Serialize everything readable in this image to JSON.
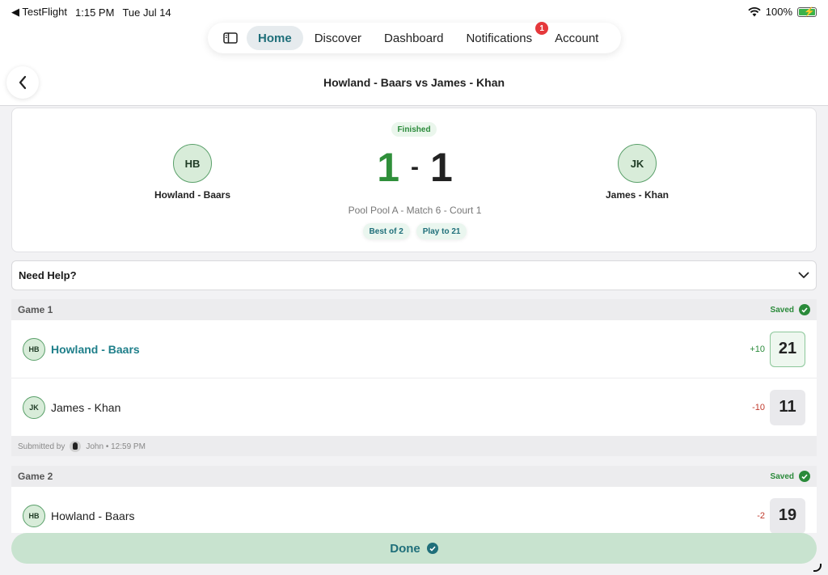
{
  "status": {
    "back_app": "◀ TestFlight",
    "time": "1:15 PM",
    "date": "Tue Jul 14",
    "battery": "100%"
  },
  "nav": {
    "items": [
      {
        "label": "Home"
      },
      {
        "label": "Discover"
      },
      {
        "label": "Dashboard"
      },
      {
        "label": "Notifications",
        "badge": "1"
      },
      {
        "label": "Account"
      }
    ]
  },
  "page": {
    "title": "Howland - Baars vs James - Khan"
  },
  "match": {
    "status": "Finished",
    "team_left": {
      "initials": "HB",
      "name": "Howland - Baars"
    },
    "team_right": {
      "initials": "JK",
      "name": "James - Khan"
    },
    "score_left": "1",
    "score_sep": "-",
    "score_right": "1",
    "info": "Pool Pool A - Match 6 - Court 1",
    "pills": [
      "Best of 2",
      "Play to 21"
    ]
  },
  "help": {
    "label": "Need Help?"
  },
  "games": [
    {
      "title": "Game 1",
      "saved": "Saved",
      "rows": [
        {
          "initials": "HB",
          "name": "Howland - Baars",
          "diff": "+10",
          "score": "21"
        },
        {
          "initials": "JK",
          "name": "James - Khan",
          "diff": "-10",
          "score": "11"
        }
      ],
      "submitted_label": "Submitted by",
      "submitted_info": "John • 12:59 PM"
    },
    {
      "title": "Game 2",
      "saved": "Saved",
      "rows": [
        {
          "initials": "HB",
          "name": "Howland - Baars",
          "diff": "-2",
          "score": "19"
        }
      ]
    }
  ],
  "footer": {
    "done_label": "Done"
  }
}
